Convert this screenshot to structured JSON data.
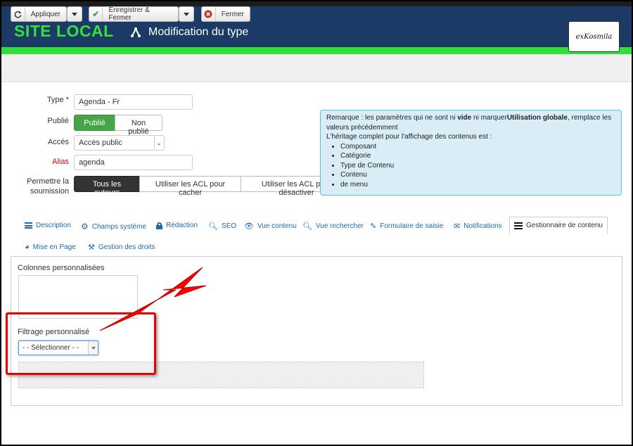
{
  "header": {
    "site_title": "SITE LOCAL",
    "page_title": "Modification du type",
    "logo_text": "exKosmila"
  },
  "toolbar": {
    "apply_label": "Appliquer",
    "save_close_label": "Enregistrer & Fermer",
    "close_label": "Fermer"
  },
  "form": {
    "type_label": "Type *",
    "type_value": "Agenda - Fr",
    "published_label": "Publié",
    "published_options": [
      "Publié",
      "Non publié"
    ],
    "access_label": "Accès",
    "access_value": "Accès public",
    "alias_label": "Alias",
    "alias_value": "agenda",
    "submission_label_1": "Permettre la",
    "submission_label_2": "soumission",
    "submission_options": [
      "Tous les auteurs",
      "Utiliser les ACL pour cacher",
      "Utiliser les ACL pour désactiver"
    ]
  },
  "note": {
    "line1_pre": "Remarque : les paramètres qui ne sont ni ",
    "line1_bold1": "vide",
    "line1_mid": " ni marquer",
    "line1_bold2": "Utilisation globale",
    "line1_post": ", remplace les",
    "line2": "valeurs précédemment",
    "line3": "L'héritage complet pour l'affichage des contenus est :",
    "items": [
      "Composant",
      "Catégorie",
      "Type de Contenu",
      "Contenu",
      "de menu"
    ]
  },
  "tabs": [
    {
      "label": "Description"
    },
    {
      "label": "Champs système"
    },
    {
      "label": "Rédaction"
    },
    {
      "label": "SEO"
    },
    {
      "label": "Vue contenu"
    },
    {
      "label": "Vue rechercher"
    },
    {
      "label": "Formulaire de saisie"
    },
    {
      "label": "Notifications"
    },
    {
      "label": "Gestionnaire de contenu"
    },
    {
      "label": "Mise en Page"
    },
    {
      "label": "Gestion des droits"
    }
  ],
  "panel": {
    "custom_columns_label": "Colonnes personnalisées",
    "custom_filter_label": "Filtrage personnalisé",
    "select_value": "-  - Sélectionner -  -"
  },
  "colors": {
    "header_bg": "#1b3a66",
    "accent_green": "#35e03d",
    "link_blue": "#1e6ab0",
    "annotation_red": "#e00000"
  }
}
